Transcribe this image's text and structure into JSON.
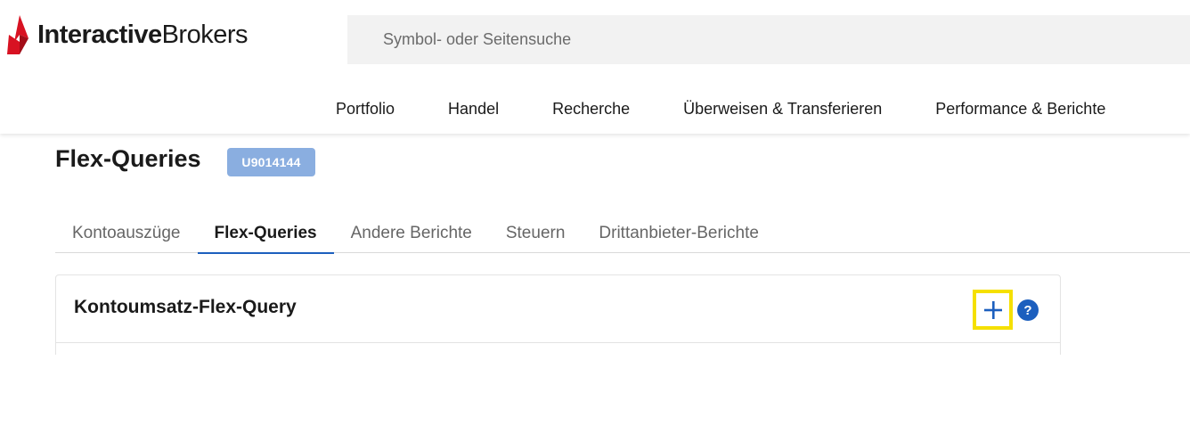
{
  "header": {
    "logo": {
      "brand_bold": "Interactive",
      "brand_light": "Brokers",
      "icon": "ib-logo-icon"
    },
    "search": {
      "placeholder": "Symbol- oder Seitensuche",
      "value": ""
    },
    "nav": [
      {
        "label": "Portfolio"
      },
      {
        "label": "Handel"
      },
      {
        "label": "Recherche"
      },
      {
        "label": "Überweisen & Transferieren"
      },
      {
        "label": "Performance & Berichte"
      }
    ]
  },
  "page": {
    "title": "Flex-Queries",
    "account_badge": "U9014144"
  },
  "tabs": [
    {
      "label": "Kontoauszüge",
      "active": false
    },
    {
      "label": "Flex-Queries",
      "active": true
    },
    {
      "label": "Andere Berichte",
      "active": false
    },
    {
      "label": "Steuern",
      "active": false
    },
    {
      "label": "Drittanbieter-Berichte",
      "active": false
    }
  ],
  "card": {
    "title": "Kontoumsatz-Flex-Query",
    "add_icon": "plus-icon",
    "help_icon": "question-icon",
    "help_glyph": "?"
  },
  "colors": {
    "accent_blue": "#1c5fbe",
    "badge_bg": "#8aaee0",
    "highlight_yellow": "#f5e000",
    "logo_red": "#d81222"
  }
}
